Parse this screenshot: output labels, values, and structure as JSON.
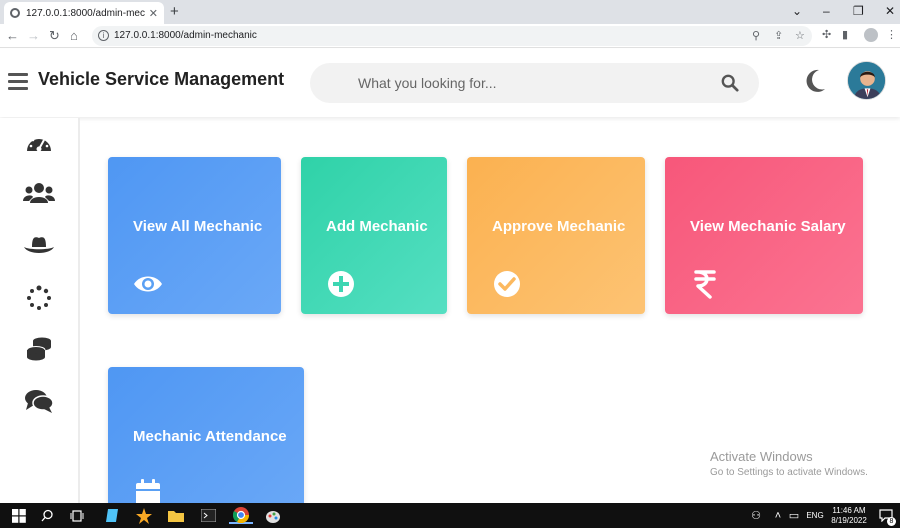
{
  "browser": {
    "tab_title": "127.0.0.1:8000/admin-mechanic",
    "url": "127.0.0.1:8000/admin-mechanic"
  },
  "header": {
    "title": "Vehicle Service Management",
    "search_placeholder": "What you looking for..."
  },
  "sidebar": {
    "items": [
      {
        "icon": "dashboard-icon"
      },
      {
        "icon": "users-icon"
      },
      {
        "icon": "hat-icon"
      },
      {
        "icon": "spinner-icon"
      },
      {
        "icon": "coins-icon"
      },
      {
        "icon": "chat-icon"
      }
    ]
  },
  "cards": [
    {
      "label": "View All Mechanic",
      "icon": "eye-icon",
      "color": "#4f97f3"
    },
    {
      "label": "Add Mechanic",
      "icon": "plus-circle-icon",
      "color": "#2fd2a8"
    },
    {
      "label": "Approve Mechanic",
      "icon": "check-circle-icon",
      "color": "#fbb150"
    },
    {
      "label": "View Mechanic Salary",
      "icon": "rupee-icon",
      "color": "#f7577a"
    },
    {
      "label": "Mechanic Attendance",
      "icon": "calendar-icon",
      "color": "#4f97f3"
    }
  ],
  "watermark": {
    "line1": "Activate Windows",
    "line2": "Go to Settings to activate Windows."
  },
  "taskbar": {
    "language": "ENG",
    "time": "11:46 AM",
    "date": "8/19/2022",
    "notification_count": "8"
  }
}
